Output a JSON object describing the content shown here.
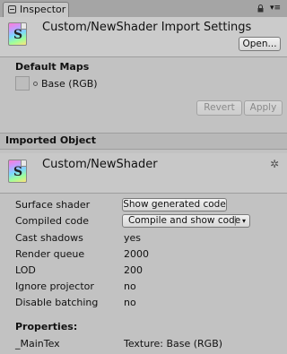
{
  "window": {
    "tab_title": "Inspector",
    "lock_icon": "lock-icon",
    "menu_icon": "menu-icon"
  },
  "header": {
    "title": "Custom/NewShader Import Settings",
    "open_button": "Open...",
    "icon": "shader-icon",
    "icon_letter": "S"
  },
  "default_maps": {
    "label": "Default Maps",
    "items": [
      {
        "name": "Base (RGB)"
      }
    ]
  },
  "actions": {
    "revert": "Revert",
    "apply": "Apply"
  },
  "imported_object": {
    "section_title": "Imported Object",
    "name": "Custom/NewShader",
    "icon_letter": "S"
  },
  "properties": {
    "surface_shader": {
      "label": "Surface shader",
      "button": "Show generated code"
    },
    "compiled_code": {
      "label": "Compiled code",
      "button": "Compile and show code",
      "arrow": "▾"
    },
    "rows": [
      {
        "label": "Cast shadows",
        "value": "yes"
      },
      {
        "label": "Render queue",
        "value": "2000"
      },
      {
        "label": "LOD",
        "value": "200"
      },
      {
        "label": "Ignore projector",
        "value": "no"
      },
      {
        "label": "Disable batching",
        "value": "no"
      }
    ],
    "props_heading": "Properties:",
    "maintex": {
      "label": "_MainTex",
      "value": "Texture: Base (RGB)"
    }
  },
  "colors": {
    "panel_bg": "#c2c2c2",
    "tab_strip": "#a5a5a5",
    "section_bar": "#b8b8b8"
  }
}
